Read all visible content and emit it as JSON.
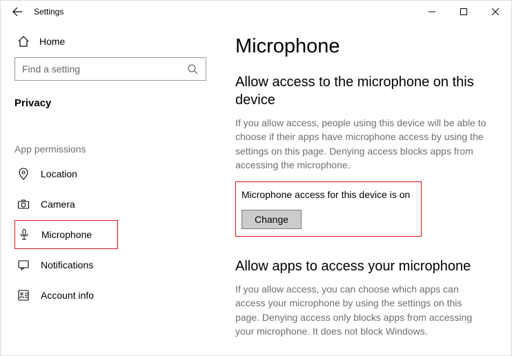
{
  "titlebar": {
    "title": "Settings"
  },
  "sidebar": {
    "home_label": "Home",
    "search_placeholder": "Find a setting",
    "category_label": "Privacy",
    "group_label": "App permissions",
    "items": [
      {
        "label": "Location"
      },
      {
        "label": "Camera"
      },
      {
        "label": "Microphone"
      },
      {
        "label": "Notifications"
      },
      {
        "label": "Account info"
      }
    ]
  },
  "content": {
    "page_title": "Microphone",
    "section1": {
      "heading": "Allow access to the microphone on this device",
      "body": "If you allow access, people using this device will be able to choose if their apps have microphone access by using the settings on this page. Denying access blocks apps from accessing the microphone.",
      "status_line": "Microphone access for this device is on",
      "change_label": "Change"
    },
    "section2": {
      "heading": "Allow apps to access your microphone",
      "body": "If you allow access, you can choose which apps can access your microphone by using the settings on this page. Denying access only blocks apps from accessing your microphone. It does not block Windows."
    }
  }
}
